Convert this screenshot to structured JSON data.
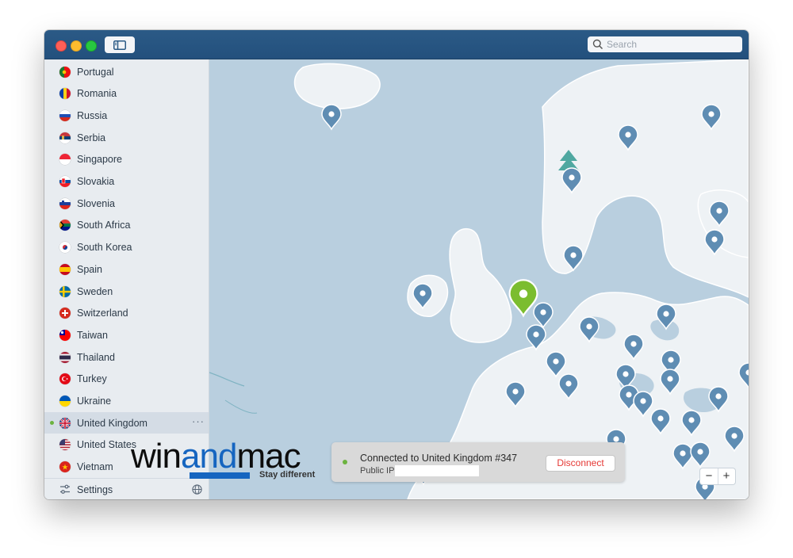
{
  "search": {
    "placeholder": "Search"
  },
  "countries": [
    {
      "name": "Portugal",
      "flag": "portugal-flag"
    },
    {
      "name": "Romania",
      "flag": "romania-flag"
    },
    {
      "name": "Russia",
      "flag": "russia-flag"
    },
    {
      "name": "Serbia",
      "flag": "serbia-flag"
    },
    {
      "name": "Singapore",
      "flag": "singapore-flag"
    },
    {
      "name": "Slovakia",
      "flag": "slovakia-flag"
    },
    {
      "name": "Slovenia",
      "flag": "slovenia-flag"
    },
    {
      "name": "South Africa",
      "flag": "south-africa-flag"
    },
    {
      "name": "South Korea",
      "flag": "south-korea-flag"
    },
    {
      "name": "Spain",
      "flag": "spain-flag"
    },
    {
      "name": "Sweden",
      "flag": "sweden-flag"
    },
    {
      "name": "Switzerland",
      "flag": "switzerland-flag"
    },
    {
      "name": "Taiwan",
      "flag": "taiwan-flag"
    },
    {
      "name": "Thailand",
      "flag": "thailand-flag"
    },
    {
      "name": "Turkey",
      "flag": "turkey-flag"
    },
    {
      "name": "Ukraine",
      "flag": "ukraine-flag"
    },
    {
      "name": "United Kingdom",
      "flag": "united-kingdom-flag",
      "selected": true,
      "connected": true
    },
    {
      "name": "United States",
      "flag": "united-states-flag"
    },
    {
      "name": "Vietnam",
      "flag": "vietnam-flag"
    }
  ],
  "settings": {
    "label": "Settings"
  },
  "status": {
    "connected_text": "Connected to United Kingdom #347",
    "ip_label": "Public IP:",
    "disconnect_label": "Disconnect"
  },
  "zoom": {
    "minus": "−",
    "plus": "+"
  },
  "watermark": {
    "win": "win",
    "and": "and",
    "mac": "mac",
    "tagline": "Stay different"
  },
  "colors": {
    "titlebar": "#23507d",
    "map_water": "#b9cfdf",
    "land": "#eef2f5",
    "pin": "#5f8db3",
    "active_pin": "#7bbd2f",
    "disconnect_text": "#e53935"
  }
}
